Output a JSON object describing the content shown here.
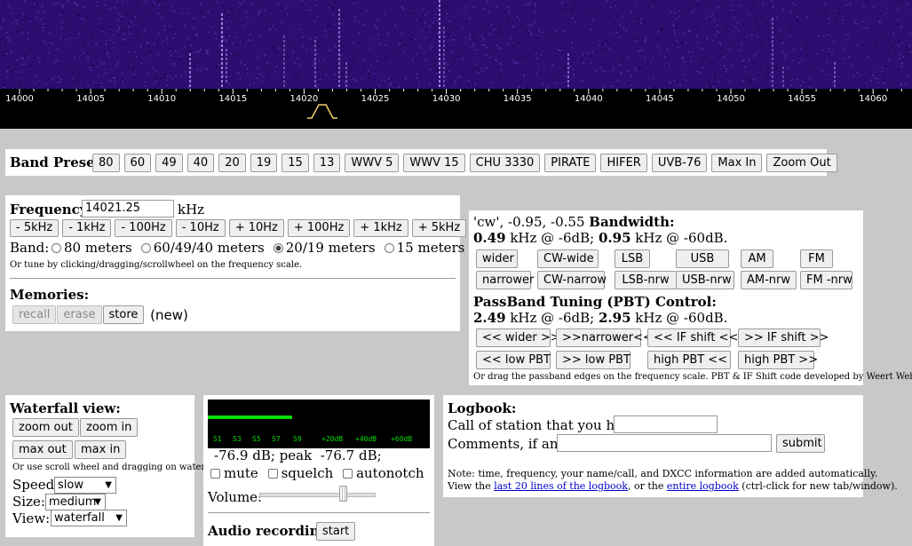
{
  "scale": {
    "ticks": [
      "14000",
      "14005",
      "14010",
      "14015",
      "14020",
      "14025",
      "14030",
      "14035",
      "14040",
      "14045",
      "14050",
      "14055",
      "14060"
    ]
  },
  "band_presets": {
    "title": "Band Presets",
    "buttons": [
      "80",
      "60",
      "49",
      "40",
      "20",
      "19",
      "15",
      "13",
      "WWV 5",
      "WWV 15",
      "CHU 3330",
      "PIRATE",
      "HIFER",
      "UVB-76",
      "Max In",
      "Zoom Out"
    ]
  },
  "frequency": {
    "label": "Frequency:",
    "value": "14021.25",
    "unit": "kHz",
    "step_buttons": [
      "- 5kHz",
      "- 1kHz",
      "- 100Hz",
      "- 10Hz",
      "+ 10Hz",
      "+ 100Hz",
      "+ 1kHz",
      "+ 5kHz"
    ],
    "band_label": "Band:",
    "bands": [
      "80 meters",
      "60/49/40 meters",
      "20/19 meters",
      "15 meters"
    ],
    "selected_band": "20/19 meters",
    "hint": "Or tune by clicking/dragging/scrollwheel on the frequency scale."
  },
  "memories": {
    "title": "Memories:",
    "recall": "recall",
    "erase": "erase",
    "store": "store",
    "status": "(new)"
  },
  "bandwidth": {
    "mode_text": "'cw', -0.95, -0.55",
    "title": "Bandwidth:",
    "val6": "0.49",
    "text6": " kHz @ -6dB; ",
    "val60": "0.95",
    "text60": " kHz @ -60dB.",
    "row1": [
      "wider",
      "CW-wide",
      "LSB",
      "USB",
      "AM",
      "FM"
    ],
    "row2": [
      "narrower",
      "CW-narrow",
      "LSB-nrw",
      "USB-nrw",
      "AM-nrw",
      "FM -nrw"
    ]
  },
  "pbt": {
    "title": "PassBand Tuning (PBT) Control:",
    "val6": "2.49",
    "text6": " kHz @ -6dB; ",
    "val60": "2.95",
    "text60": " kHz @ -60dB.",
    "row1": [
      "<< wider >>",
      ">>narrower<<",
      "<< IF shift <<",
      ">> IF shift >>"
    ],
    "row2": [
      "<< low PBT",
      ">> low PBT",
      "high PBT <<",
      "high PBT >>"
    ],
    "hint": "Or drag the passband edges on the frequency scale. PBT & IF Shift code developed by Weert Websdr."
  },
  "waterfall_view": {
    "title": "Waterfall view:",
    "zoom_out": "zoom out",
    "zoom_in": "zoom in",
    "max_out": "max out",
    "max_in": "max in",
    "hint": "Or use scroll wheel and dragging on waterfall.",
    "speed_label": "Speed:",
    "speed": "slow",
    "size_label": "Size:",
    "size": "medium",
    "view_label": "View:",
    "view": "waterfall"
  },
  "smeter": {
    "labels": [
      "S1",
      "S3",
      "S5",
      "S7",
      "S9",
      "+20dB",
      "+40dB",
      "+60dB"
    ],
    "level_fraction": 0.38,
    "readout": "-76.9 dB; peak  -76.7 dB;",
    "mute": "mute",
    "squelch": "squelch",
    "autonotch": "autonotch",
    "volume_label": "Volume:",
    "volume_fraction": 0.74,
    "recording_label": "Audio recording:",
    "start": "start"
  },
  "logbook": {
    "title": "Logbook:",
    "call_label": "Call of station that you hear:",
    "comments_label": "Comments, if any:",
    "submit": "submit",
    "note1": "Note: time, frequency, your name/call, and DXCC information are added automatically.",
    "note2_a": "View the ",
    "link1": "last 20 lines of the logbook",
    "note2_b": ", or the ",
    "link2": "entire logbook",
    "note2_c": " (ctrl-click for new tab/window)."
  },
  "colors": {
    "waterfall_bg": "#2c0e70",
    "signal": "#cfa8ff",
    "meter_green": "#00dd00",
    "meter_bg": "#000000"
  }
}
